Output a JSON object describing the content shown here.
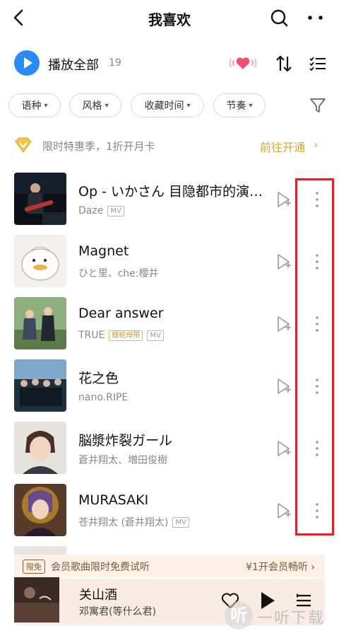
{
  "header": {
    "title": "我喜欢"
  },
  "play_all": {
    "label": "播放全部",
    "count": "19"
  },
  "filters": [
    {
      "label": "语种"
    },
    {
      "label": "风格"
    },
    {
      "label": "收藏时间"
    },
    {
      "label": "节奏"
    }
  ],
  "promo": {
    "text": "限时特惠季，1折开月卡",
    "link": "前往开通"
  },
  "songs": [
    {
      "title": "Op - いかさん 目隐都市的演绎者",
      "artist": "Daze",
      "mv": "MV",
      "vip": ""
    },
    {
      "title": "Magnet",
      "artist": "ひと里、che:櫻井",
      "mv": "",
      "vip": ""
    },
    {
      "title": "Dear answer",
      "artist": "TRUE",
      "mv": "MV",
      "vip": "蝰蛇母带"
    },
    {
      "title": "花之色",
      "artist": "nano.RIPE",
      "mv": "",
      "vip": ""
    },
    {
      "title": "脳漿炸裂ガール",
      "artist": "蒼井翔太、増田俊樹",
      "mv": "",
      "vip": ""
    },
    {
      "title": "MURASAKI",
      "artist": "苍井翔太 (蒼井翔太)",
      "mv": "MV",
      "vip": ""
    }
  ],
  "trial": {
    "badge": "限免",
    "text": "会员歌曲限时免费试听",
    "cta": "¥1开会员畅听 ›"
  },
  "player": {
    "title": "关山酒",
    "artist": "邓寓君(等什么君)"
  },
  "watermark": {
    "logo": "听",
    "text": "一听下载"
  },
  "colors": {
    "accent": "#2a8af6",
    "vip_gold": "#d8a531",
    "highlight": "#d9262e",
    "heart": "#f0506e"
  }
}
